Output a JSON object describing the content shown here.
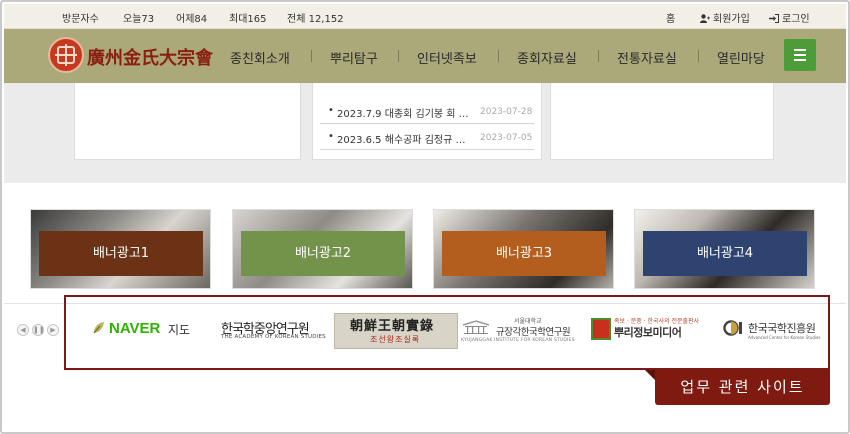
{
  "topbar": {
    "stats": {
      "visitors_label": "방문자수",
      "today": "오늘73",
      "yesterday": "어제84",
      "max": "최대165",
      "total": "전체 12,152"
    },
    "home": "홈",
    "signup": "회원가입",
    "login": "로그인"
  },
  "nav": {
    "logo_text": "廣州金氏大宗會",
    "menu": [
      "종친회소개",
      "뿌리탐구",
      "인터넷족보",
      "종회자료실",
      "전통자료실",
      "열린마당"
    ],
    "accent_color": "#4c9c3a",
    "bar_color": "#aba97a"
  },
  "news": [
    {
      "title": "2023.7.9 대종회 김기봉 회 …",
      "date": "2023-07-28"
    },
    {
      "title": "2023.6.5 해수공파 김정규 …",
      "date": "2023-07-05"
    }
  ],
  "banners": [
    {
      "label": "배너광고1",
      "color": "#6b3215"
    },
    {
      "label": "배너광고2",
      "color": "#73934b"
    },
    {
      "label": "배너광고3",
      "color": "#b35e1f"
    },
    {
      "label": "배너광고4",
      "color": "#2f4371"
    }
  ],
  "sites": {
    "naver": "NAVER",
    "naver_sub": "지도",
    "aks_ko": "한국학중앙연구원",
    "aks_en": "THE ACADEMY OF KOREAN STUDIES",
    "sillok_han": "朝鮮王朝實錄",
    "sillok_ko": "조선왕조실록",
    "kyu_top": "서울대학교",
    "kyu_main": "규장각한국학연구원",
    "kyu_en": "KYUJANGGAK INSTITUTE FOR KOREAN STUDIES",
    "puri_small": "족보 · 문중 · 한국사의 전문출판사",
    "puri_main": "뿌리정보미디어",
    "kcc_main": "한국국학진흥원",
    "kcc_en": "Advanced Center for Korean Studies"
  },
  "related_tag": "업무 관련 사이트",
  "slider_controls": [
    "prev",
    "pause",
    "next"
  ]
}
